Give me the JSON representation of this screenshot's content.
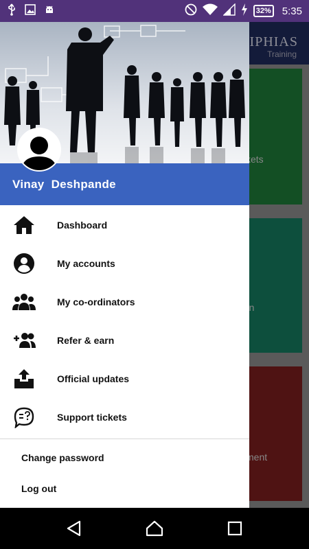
{
  "status_bar": {
    "battery_percent": "32%",
    "time": "5:35",
    "icons": [
      "usb-icon",
      "image-icon",
      "android-icon",
      "do-not-disturb-icon",
      "wifi-icon",
      "signal-icon",
      "charging-icon"
    ]
  },
  "background_app": {
    "brand": "KIPHIAS",
    "brand_sub": "Training",
    "tiles": [
      {
        "text": "kets",
        "color": "#1e7a38"
      },
      {
        "text": "rn",
        "color": "#157a5e"
      },
      {
        "text": "ment",
        "color": "#7a1e1e"
      }
    ]
  },
  "drawer": {
    "user_name": "Vinay  Deshpande",
    "menu": [
      {
        "label": "Dashboard",
        "icon": "home-icon"
      },
      {
        "label": "My accounts",
        "icon": "account-circle-icon"
      },
      {
        "label": "My co-ordinators",
        "icon": "group-icon"
      },
      {
        "label": "Refer & earn",
        "icon": "group-add-icon"
      },
      {
        "label": "Official updates",
        "icon": "inbox-upload-icon"
      },
      {
        "label": "Support tickets",
        "icon": "help-chat-icon"
      }
    ],
    "secondary": [
      {
        "label": "Change password"
      },
      {
        "label": "Log out"
      }
    ]
  },
  "colors": {
    "status_bar": "#51327a",
    "user_band": "#3a63bf"
  }
}
